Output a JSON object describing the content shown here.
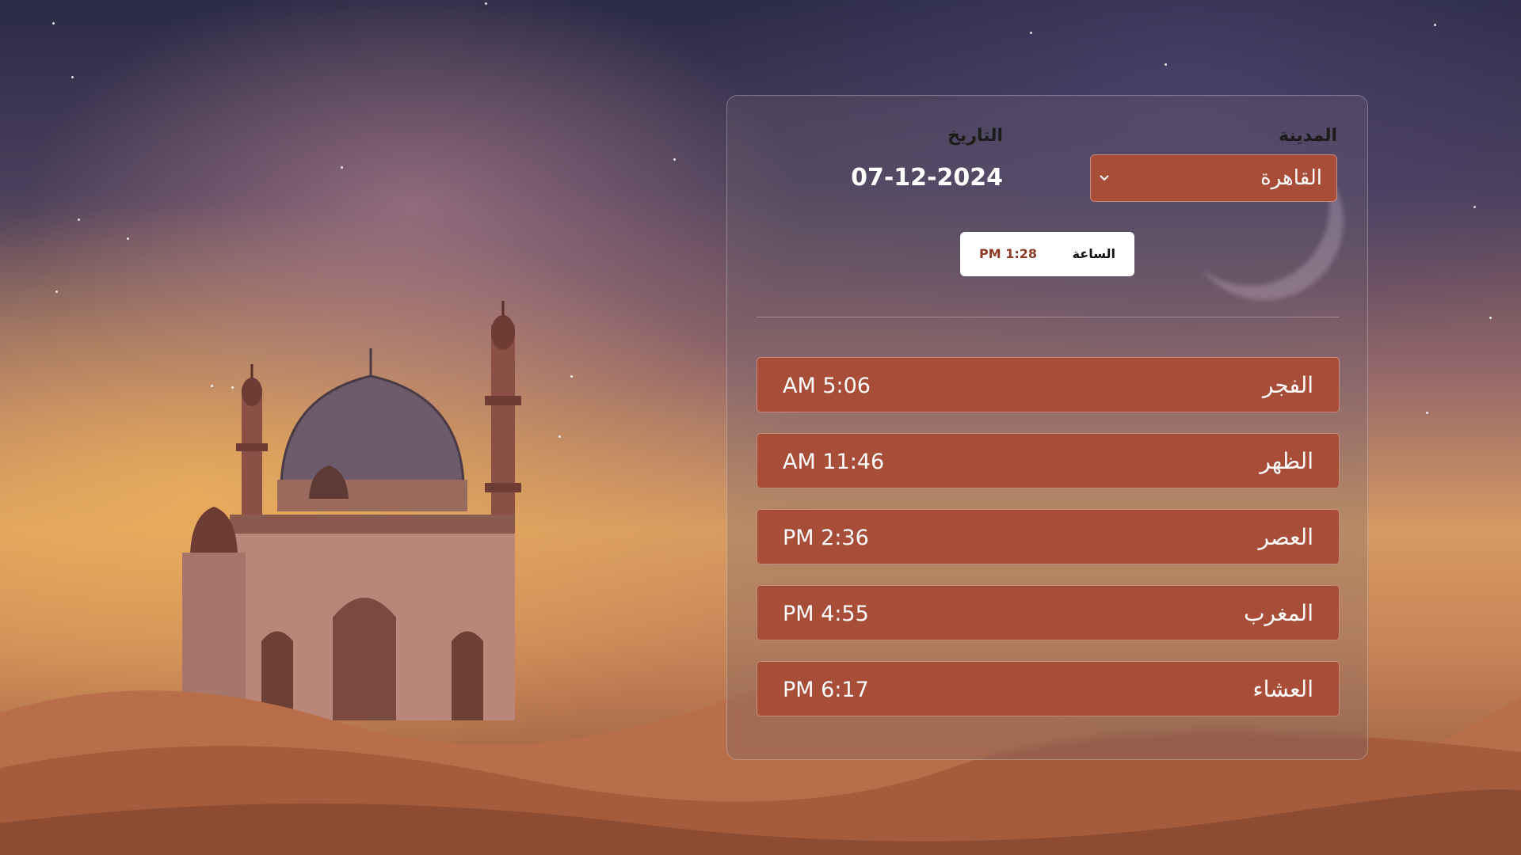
{
  "form": {
    "city_label": "المدينة",
    "city_selected": "القاهرة",
    "date_label": "التاريخ",
    "date_value": "07-12-2024"
  },
  "clock": {
    "label": "الساعة",
    "time": "PM 1:28"
  },
  "prayers": [
    {
      "name": "الفجر",
      "time": "AM 5:06"
    },
    {
      "name": "الظهر",
      "time": "AM 11:46"
    },
    {
      "name": "العصر",
      "time": "PM 2:36"
    },
    {
      "name": "المغرب",
      "time": "PM 4:55"
    },
    {
      "name": "العشاء",
      "time": "PM 6:17"
    }
  ],
  "colors": {
    "accent": "#a84e38",
    "clock_time": "#8b3a26"
  },
  "icons": {
    "city_select": "chevron-down-icon",
    "background": "mosque-illustration"
  }
}
